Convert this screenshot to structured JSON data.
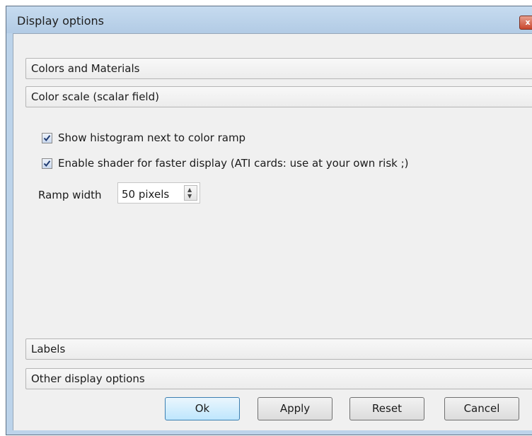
{
  "window": {
    "title": "Display options",
    "close_glyph": "x"
  },
  "sections": {
    "colors_materials": "Colors and Materials",
    "color_scale": "Color scale (scalar field)",
    "labels": "Labels",
    "other_display": "Other display options"
  },
  "color_scale_panel": {
    "show_histogram": {
      "label": "Show histogram next to color ramp",
      "checked": true
    },
    "enable_shader": {
      "label": "Enable shader for faster display (ATI cards: use at your own risk ;)",
      "checked": true
    },
    "ramp_width": {
      "label": "Ramp width",
      "value": "50 pixels"
    }
  },
  "buttons": {
    "ok": "Ok",
    "apply": "Apply",
    "reset": "Reset",
    "cancel": "Cancel"
  },
  "colors": {
    "titlebar": "#bcd3ea",
    "client_bg": "#f0f0f0",
    "default_button_border": "#3c7fb1"
  }
}
